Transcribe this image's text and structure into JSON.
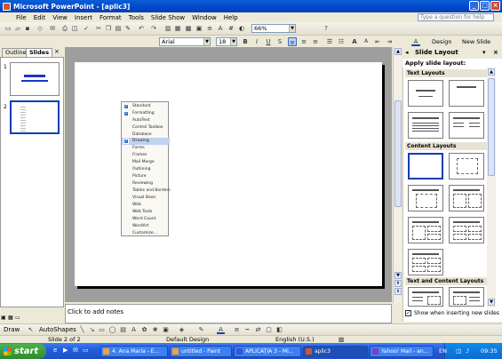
{
  "window": {
    "title": "Microsoft PowerPoint - [aplic3]",
    "controls": [
      "_",
      "□",
      "×"
    ]
  },
  "menubar": {
    "items": [
      "File",
      "Edit",
      "View",
      "Insert",
      "Format",
      "Tools",
      "Slide Show",
      "Window",
      "Help"
    ],
    "help_placeholder": "Type a question for help"
  },
  "toolbar": {
    "zoom": "66%",
    "font": "Arial",
    "font_size": "18",
    "bold": "B",
    "italic": "I",
    "underline": "U",
    "shadow": "S",
    "design_label": "Design",
    "new_slide_label": "New Slide"
  },
  "left_pane": {
    "tab_outline": "Outline",
    "tab_slides": "Slides",
    "slide_numbers": [
      "1",
      "2"
    ]
  },
  "toolbars_menu": {
    "items": [
      {
        "label": "Standard",
        "checked": true
      },
      {
        "label": "Formatting",
        "checked": true
      },
      {
        "label": "AutoText",
        "checked": false
      },
      {
        "label": "Control Toolbox",
        "checked": false
      },
      {
        "label": "Database",
        "checked": false
      },
      {
        "label": "Drawing",
        "checked": true
      },
      {
        "label": "Forms",
        "checked": false
      },
      {
        "label": "Frames",
        "checked": false
      },
      {
        "label": "Mail Merge",
        "checked": false
      },
      {
        "label": "Outlining",
        "checked": false
      },
      {
        "label": "Picture",
        "checked": false
      },
      {
        "label": "Reviewing",
        "checked": false
      },
      {
        "label": "Tables and Borders",
        "checked": false
      },
      {
        "label": "Visual Basic",
        "checked": false
      },
      {
        "label": "Web",
        "checked": false
      },
      {
        "label": "Web Tools",
        "checked": false
      },
      {
        "label": "Word Count",
        "checked": false
      },
      {
        "label": "WordArt",
        "checked": false
      },
      {
        "label": "Customize...",
        "checked": false
      }
    ],
    "highlighted": "Drawing"
  },
  "notes": {
    "placeholder": "Click to add notes"
  },
  "task_pane": {
    "title": "Slide Layout",
    "apply_label": "Apply slide layout:",
    "sections": [
      "Text Layouts",
      "Content Layouts",
      "Text and Content Layouts"
    ],
    "show_checkbox_label": "Show when inserting new slides",
    "show_checked": true
  },
  "draw_toolbar": {
    "draw_label": "Draw",
    "autoshapes_label": "AutoShapes"
  },
  "statusbar": {
    "slide_info": "Slide 2 of 2",
    "design": "Default Design",
    "language": "English (U.S.)"
  },
  "taskbar": {
    "start_label": "start",
    "tasks": [
      {
        "label": "4. Ana Maria - E...",
        "active": false
      },
      {
        "label": "untitled - Paint",
        "active": false
      },
      {
        "label": "APLICAȚIA 3 - Mi...",
        "active": false
      },
      {
        "label": "aplic3",
        "active": true
      },
      {
        "label": "Yahoo! Mail - an...",
        "active": false
      }
    ],
    "lang": "EN",
    "clock": "09:35"
  }
}
